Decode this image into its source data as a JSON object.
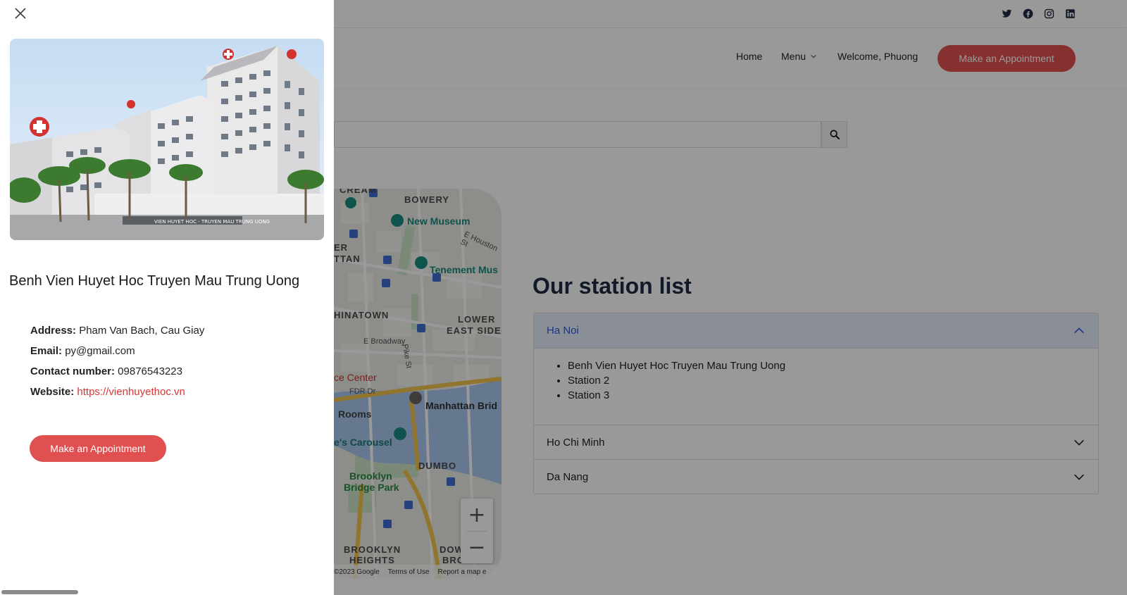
{
  "topbar": {
    "social_icons": [
      "twitter-icon",
      "facebook-icon",
      "instagram-icon",
      "linkedin-icon"
    ]
  },
  "nav": {
    "home": "Home",
    "menu": "Menu",
    "welcome": "Welcome, Phuong",
    "appointment": "Make an Appointment"
  },
  "search": {
    "placeholder": ""
  },
  "map": {
    "labels": {
      "bowery": "BOWERY",
      "new_museum": "New Museum",
      "tenement": "Tenement Mus",
      "chinatown": "HINATOWN",
      "lower_east": "LOWER",
      "east_side": "EAST SIDE",
      "er": "ER",
      "ttan": "TTAN",
      "cream": "CREAM",
      "houston": "E Houston St",
      "broadway": "E Broadway",
      "pike": "Pike St",
      "center": "ce Center",
      "fdr": "FDR Dr",
      "rooms": "Rooms",
      "manhattan_bridge": "Manhattan Brid",
      "carousel": "e's Carousel",
      "dumbo": "DUMBO",
      "brooklyn": "Brooklyn",
      "bridge_park": "Bridge Park",
      "brooklyn_heights": "BROOKLYN",
      "heights": "HEIGHTS",
      "dow": "DOW",
      "bro": "BRO"
    },
    "zoom_in": "+",
    "zoom_out": "−",
    "footer": {
      "copyright": "©2023 Google",
      "terms": "Terms of Use",
      "report": "Report a map e"
    }
  },
  "stations": {
    "title": "Our station list",
    "regions": [
      {
        "name": "Ha Noi",
        "items": [
          "Benh Vien Huyet Hoc Truyen Mau Trung Uong",
          "Station 2",
          "Station 3"
        ]
      },
      {
        "name": "Ho Chi Minh"
      },
      {
        "name": "Da Nang"
      }
    ]
  },
  "drawer": {
    "title": "Benh Vien Huyet Hoc Truyen Mau Trung Uong",
    "address_label": "Address:",
    "address": "Pham Van Bach, Cau Giay",
    "email_label": "Email:",
    "email": "py@gmail.com",
    "contact_label": "Contact number:",
    "contact": "09876543223",
    "website_label": "Website:",
    "website": "https://vienhuyethoc.vn",
    "appointment": "Make an Appointment",
    "photo_text": "VIEN HUYET HOC - TRUYEN MAU TRUNG UONG"
  },
  "colors": {
    "accent": "#e05050",
    "navy": "#1e2a44",
    "link_red": "#d33333",
    "accordion_active": "#e6eefc"
  }
}
